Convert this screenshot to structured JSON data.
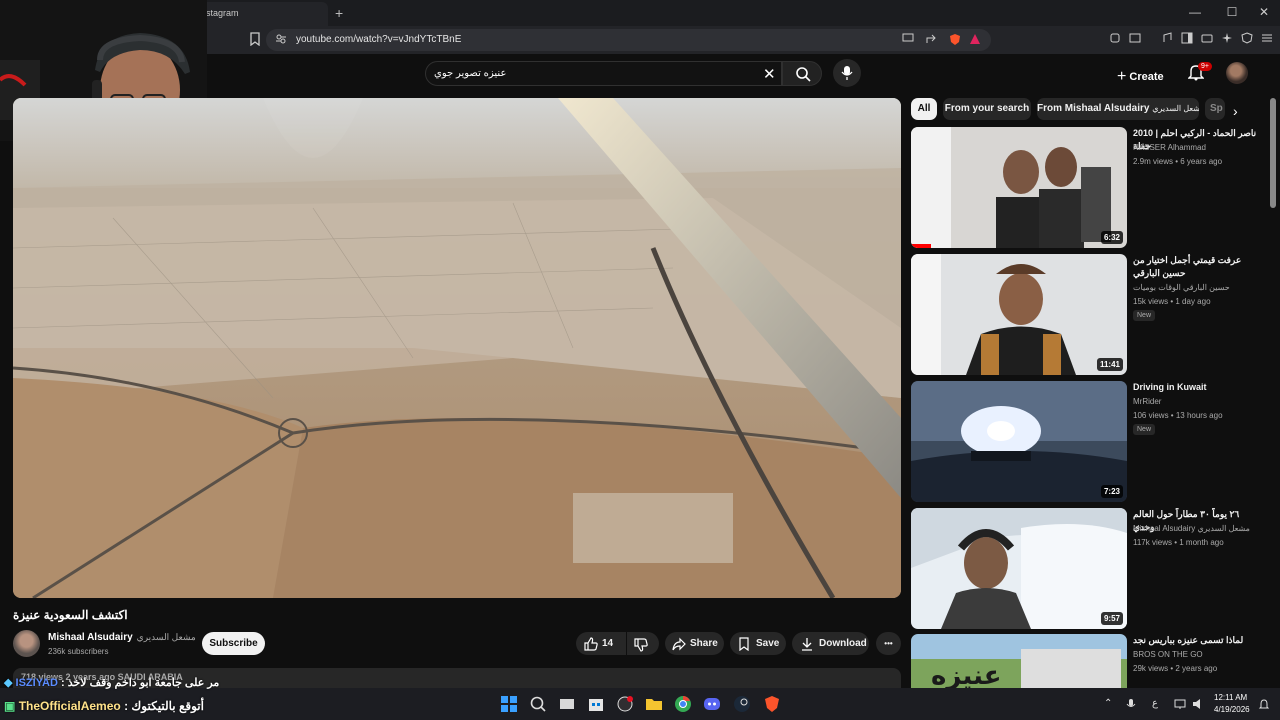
{
  "browser": {
    "tab_title": "stagram",
    "url": "youtube.com/watch?v=vJndYTcTBnE",
    "win_min": "—",
    "win_max": "☐",
    "win_close": "✕",
    "newtab": "+"
  },
  "youtube": {
    "search_query": "عنيزه تصوير جوي",
    "create_label": "Create",
    "notif_count": "9+"
  },
  "video": {
    "title": "اكتشف السعودية عنيزة",
    "channel_name": "Mishaal Alsudairy",
    "channel_name_ar": "مشعل السديري",
    "subscribers": "236k subscribers",
    "subscribe_label": "Subscribe",
    "likes": "14",
    "share_label": "Share",
    "save_label": "Save",
    "download_label": "Download",
    "more_label": "•••",
    "description": "718 views  2 years ago  SAUDI ARABIA"
  },
  "chips": [
    "All",
    "From your search",
    "From Mishaal Alsudairy",
    "مشعل السديري",
    "Sp"
  ],
  "recommendations": [
    {
      "title": "2010 ناصر الحماد - الركبي احلم | حفلة",
      "channel": "NASSER Alhammad",
      "meta": "2.9m views • 6 years ago",
      "duration": "6:32",
      "badge": ""
    },
    {
      "title": "عرفت قيمتي أجمل اختيار من حسين البارقي",
      "channel": "حسين البارقي الوقات بوميات",
      "meta": "15k views • 1 day ago",
      "duration": "11:41",
      "badge": "New"
    },
    {
      "title": "Driving  in Kuwait",
      "channel": "MrRider",
      "meta": "106 views • 13 hours ago",
      "duration": "7:23",
      "badge": "New"
    },
    {
      "title": "٢٦ يوماً ٣٠ مطاراً حول العالم وحدي",
      "channel": "Mishaal Alsudairy مشعل السديري",
      "meta": "117k views • 1 month ago",
      "duration": "9:57",
      "badge": ""
    },
    {
      "title": "لماذا تسمى عنيزه بباريس نجد",
      "channel": "BROS ON THE GO",
      "meta": "29k views • 2 years ago",
      "duration": "",
      "badge": ""
    }
  ],
  "chat": [
    {
      "user": "ISZIYAD",
      "message": ": مر على جامعة ابو داخم وقف لاخذ"
    },
    {
      "user": "TheOfficialAemeo",
      "message": ": أتوقع بالتيكتوك"
    }
  ],
  "taskbar": {
    "time": "12:11 AM",
    "date": "4/19/2026"
  },
  "colors": {
    "accent": "#cc0000",
    "background": "#0f0f0f",
    "chip_active": "#f1f1f1"
  }
}
